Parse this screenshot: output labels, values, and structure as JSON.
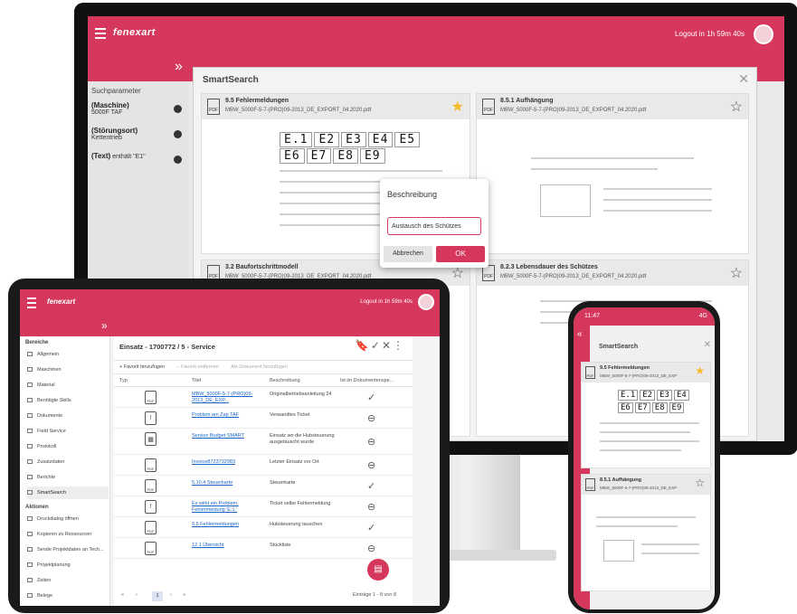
{
  "colors": {
    "brand": "#d6375c",
    "link": "#1a64c8",
    "star_favorite": "#f4bb2a"
  },
  "monitor": {
    "logo": "fenexart",
    "logout": "Logout in 1h 59m 40s",
    "filter_heading": "Suchparameter",
    "filters": [
      {
        "label": "(Maschine)",
        "value": "5000F TAF"
      },
      {
        "label": "(Störungsort)",
        "value": "Kettentrieb"
      },
      {
        "label": "(Text)",
        "value": "enthält \"E1\""
      }
    ],
    "smartsearch": {
      "title": "SmartSearch",
      "cards": [
        {
          "title": "9.5 Fehlermeldungen",
          "file": "MBW_5000F-5-7-(PRO)09-2013_DE_EXPORT_04.2020.pdf",
          "favorite": true
        },
        {
          "title": "8.5.1 Aufhängung",
          "file": "MBW_5000F-5-7-(PRO)09-2013_DE_EXPORT_04.2020.pdf",
          "favorite": false
        },
        {
          "title": "3.2 Baufortschrittmodell",
          "file": "MBW_5000F-5-7-(PRO)09-2013_DE_EXPORT_04.2020.pdf",
          "favorite": false
        },
        {
          "title": "8.2.3 Lebensdauer des Schützes",
          "file": "MBW_5000F-5-7-(PRO)09-2013_DE_EXPORT_04.2020.pdf",
          "favorite": false
        }
      ],
      "codes_row1": [
        "E.1",
        "E2",
        "E3",
        "E4",
        "E5"
      ],
      "codes_row2": [
        "E6",
        "E7",
        "E8",
        "E9"
      ]
    },
    "dialog": {
      "title": "Beschreibung",
      "input_value": "Austausch des Schützes",
      "cancel": "Abbrechen",
      "ok": "OK"
    }
  },
  "tablet": {
    "logo": "fenexart",
    "logout": "Logout in 1h 59m 40s",
    "sidebar": {
      "section_area": "Bereiche",
      "items": [
        "Allgemein",
        "Maschinen",
        "Material",
        "Benötigte Skills",
        "Dokumente",
        "Field Service",
        "Protokoll",
        "Zusatzdaten",
        "Berichte",
        "SmartSearch"
      ],
      "section_actions": "Aktionen",
      "actions": [
        "Druckdialog öffnen",
        "Kopieren zu Ressourcen",
        "Sende Projektdaten an Tech...",
        "Projektplanung",
        "Zeiten",
        "Belege"
      ]
    },
    "main": {
      "title": "Einsatz - 1700772 / 5 - Service",
      "toolbar": [
        "+ Favorit hinzufügen",
        "– Favorit entfernen",
        "Als Dokument hinzufügen"
      ],
      "columns": [
        "Typ",
        "Titel",
        "Beschreibung",
        "Ist im Dokumentenspe..."
      ],
      "rows": [
        {
          "title": "MBW_5000F-5-7-(PRO)09-2013_DE_EXP...",
          "desc": "Originalbetriebsanleitung 24",
          "status": "check"
        },
        {
          "title": "Problem am Zap TAF",
          "desc": "Verwandtes Ticket",
          "status": "minus"
        },
        {
          "title": "Service Budget SMART",
          "desc": "Einsatz wo die Hubsteuerung ausgetauscht wurde",
          "status": "minus"
        },
        {
          "title": "Invoice8723732983",
          "desc": "Letzter Einsatz vor Ort",
          "status": "minus"
        },
        {
          "title": "5.10.4 Steuerkarte",
          "desc": "Steuerkarte",
          "status": "check"
        },
        {
          "title": "Es wirkt ein Problem, Fehlermeldung 'E.1.'",
          "desc": "Ticket selbe Fehlermeldung",
          "status": "minus"
        },
        {
          "title": "9.5 Fehlermeldungen",
          "desc": "Hubsteuerung tauschen",
          "status": "check"
        },
        {
          "title": "12.1 Übersicht",
          "desc": "Stückliste",
          "status": "minus"
        }
      ],
      "pager_page": "1",
      "pager_info": "Einträge 1 - 8 von 8"
    }
  },
  "phone": {
    "time": "11:47",
    "signal": "4G",
    "title": "SmartSearch",
    "cards": [
      {
        "title": "9.5 Fehlermeldungen",
        "file": "MBW_5000F-5-7-(PRO)09-2013_DE_EXP",
        "favorite": true
      },
      {
        "title": "8.5.1 Aufhängung",
        "file": "MBW_5000F-5-7-(PRO)09-2013_DE_EXP",
        "favorite": false
      }
    ]
  }
}
